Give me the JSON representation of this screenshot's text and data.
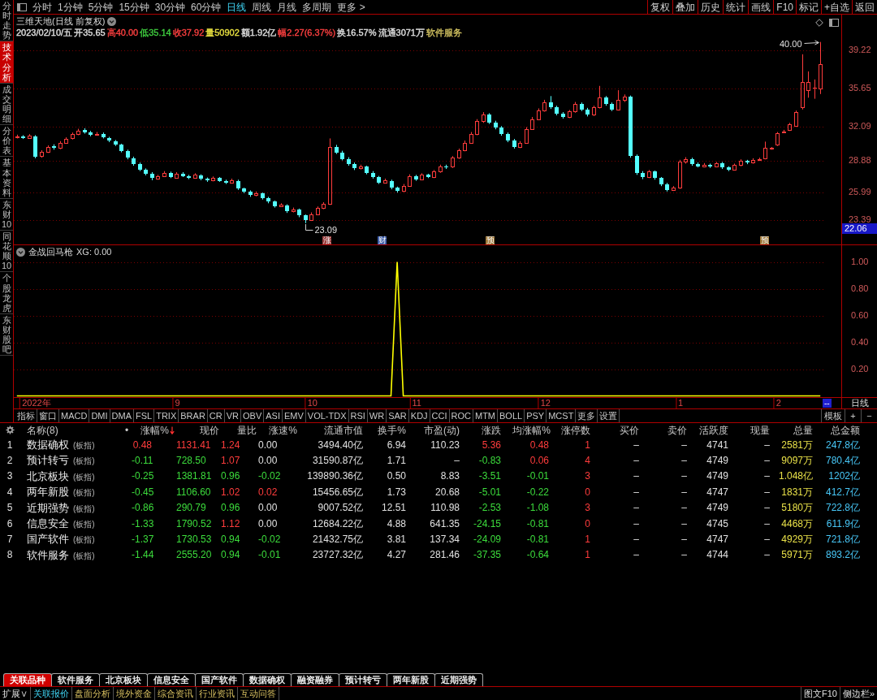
{
  "sidebar": {
    "tabs": [
      {
        "label": "分时走势",
        "selected": false
      },
      {
        "label": "技术分析",
        "selected": true
      },
      {
        "label": "成交明细",
        "selected": false
      },
      {
        "label": "分价表",
        "selected": false
      },
      {
        "label": "基本资料",
        "selected": false
      },
      {
        "label": "东财10",
        "selected": false
      },
      {
        "label": "同花顺10",
        "selected": false
      },
      {
        "label": "个股龙虎",
        "selected": false
      },
      {
        "label": "东财股吧",
        "selected": false
      }
    ]
  },
  "toolbar": {
    "periods": [
      {
        "label": "分时",
        "selected": false
      },
      {
        "label": "1分钟",
        "selected": false
      },
      {
        "label": "5分钟",
        "selected": false
      },
      {
        "label": "15分钟",
        "selected": false
      },
      {
        "label": "30分钟",
        "selected": false
      },
      {
        "label": "60分钟",
        "selected": false
      },
      {
        "label": "日线",
        "selected": true
      },
      {
        "label": "周线",
        "selected": false
      },
      {
        "label": "月线",
        "selected": false
      },
      {
        "label": "多周期",
        "selected": false
      },
      {
        "label": "更多 >",
        "selected": false
      }
    ],
    "actions": [
      "复权",
      "叠加",
      "历史",
      "统计",
      "画线",
      "F10",
      "标记",
      "+自选",
      "返回"
    ]
  },
  "quote": {
    "title": "三维天地(日线 前复权)",
    "items": [
      {
        "text": "2023/02/10/五",
        "color": "#e0e0e0"
      },
      {
        "text": "开35.65",
        "color": "#e0e0e0"
      },
      {
        "text": "高40.00",
        "color": "#ff4040"
      },
      {
        "text": "低35.14",
        "color": "#40d040"
      },
      {
        "text": "收37.92",
        "color": "#ff4040"
      },
      {
        "text": "量50902",
        "color": "#e8e040"
      },
      {
        "text": "额1.92亿",
        "color": "#e0e0e0"
      },
      {
        "text": "幅2.27(6.37%)",
        "color": "#ff4040"
      },
      {
        "text": "换16.57%",
        "color": "#e0e0e0"
      },
      {
        "text": "流通3071万",
        "color": "#e0e0e0"
      },
      {
        "text": "软件服务",
        "color": "#d0c060"
      }
    ]
  },
  "price_chart": {
    "cursor_price": "22.06",
    "high_marker": "40.00",
    "low_marker": "23.09",
    "events": [
      {
        "text": "涨",
        "color": "#9a3a3a"
      },
      {
        "text": "财",
        "color": "#3a5aa8"
      },
      {
        "text": "预",
        "color": "#a07838"
      },
      {
        "text": "预",
        "color": "#a07838"
      }
    ],
    "chart_data": {
      "type": "candlestick",
      "grid": true,
      "ylim": [
        21.11,
        42.55
      ],
      "yticks": [
        39.22,
        35.65,
        32.09,
        28.88,
        25.99,
        23.39
      ],
      "categories": [
        null,
        null,
        null,
        null,
        null,
        null,
        null,
        null,
        null,
        null,
        null,
        null,
        null,
        null,
        null,
        null,
        null,
        null,
        null,
        null,
        null,
        null,
        null,
        null,
        null,
        null,
        null,
        null,
        null,
        null,
        null,
        null,
        null,
        null,
        null,
        null,
        null,
        null,
        null,
        null,
        null,
        null,
        null,
        null,
        null,
        null,
        null,
        null,
        null,
        null,
        null,
        null,
        null,
        null,
        null,
        null,
        null,
        null,
        null,
        null,
        null,
        null,
        null,
        null,
        null,
        null,
        null,
        null,
        null,
        null,
        null,
        null,
        null,
        null,
        null,
        null,
        null,
        null,
        null,
        null,
        null,
        null,
        null,
        null,
        null,
        null,
        null,
        null,
        null,
        null,
        null,
        null,
        null,
        null,
        null,
        null,
        null,
        null,
        null,
        null,
        null,
        null,
        null,
        null,
        null,
        null,
        null,
        null,
        null,
        null,
        null,
        null,
        null,
        null,
        null,
        null,
        null,
        null,
        null,
        null,
        null,
        null,
        null,
        null,
        null,
        null,
        null,
        null,
        null,
        null,
        null,
        null
      ],
      "ohlc": [
        [
          31.1,
          31.35,
          31.0,
          31.2
        ],
        [
          31.15,
          31.3,
          30.95,
          31.05
        ],
        [
          31.05,
          31.4,
          30.98,
          31.25
        ],
        [
          31.2,
          31.3,
          29.15,
          29.3
        ],
        [
          29.35,
          29.9,
          29.2,
          29.75
        ],
        [
          29.75,
          30.35,
          29.65,
          30.2
        ],
        [
          30.25,
          30.45,
          29.95,
          30.1
        ],
        [
          30.1,
          30.75,
          30.0,
          30.6
        ],
        [
          30.6,
          31.1,
          30.5,
          30.95
        ],
        [
          31.0,
          31.55,
          30.9,
          31.4
        ],
        [
          31.4,
          31.9,
          31.3,
          31.75
        ],
        [
          31.8,
          31.95,
          31.45,
          31.55
        ],
        [
          31.55,
          31.7,
          31.2,
          31.35
        ],
        [
          31.35,
          31.6,
          31.25,
          31.45
        ],
        [
          31.45,
          31.55,
          31.0,
          31.1
        ],
        [
          31.05,
          31.15,
          30.65,
          30.8
        ],
        [
          30.75,
          30.85,
          30.3,
          30.4
        ],
        [
          30.4,
          30.5,
          29.7,
          29.8
        ],
        [
          29.8,
          29.95,
          29.05,
          29.2
        ],
        [
          29.15,
          29.3,
          28.45,
          28.6
        ],
        [
          28.6,
          28.75,
          27.95,
          28.1
        ],
        [
          28.1,
          28.2,
          27.55,
          27.7
        ],
        [
          27.7,
          27.85,
          27.1,
          27.3
        ],
        [
          27.25,
          27.6,
          27.15,
          27.45
        ],
        [
          27.5,
          27.95,
          27.4,
          27.8
        ],
        [
          27.8,
          27.9,
          27.3,
          27.4
        ],
        [
          27.35,
          27.85,
          27.25,
          27.7
        ],
        [
          27.7,
          27.85,
          27.4,
          27.5
        ],
        [
          27.5,
          27.6,
          27.2,
          27.35
        ],
        [
          27.35,
          27.75,
          27.25,
          27.6
        ],
        [
          27.55,
          27.65,
          27.1,
          27.25
        ],
        [
          27.25,
          27.35,
          26.95,
          27.1
        ],
        [
          27.1,
          27.45,
          27.0,
          27.3
        ],
        [
          27.3,
          27.4,
          26.95,
          27.05
        ],
        [
          27.05,
          27.15,
          26.75,
          26.9
        ],
        [
          26.9,
          27.25,
          26.8,
          27.1
        ],
        [
          27.05,
          27.15,
          26.2,
          26.3
        ],
        [
          26.3,
          26.4,
          25.9,
          26.05
        ],
        [
          26.05,
          26.15,
          25.55,
          25.7
        ],
        [
          25.7,
          26.05,
          25.6,
          25.9
        ],
        [
          25.85,
          25.95,
          25.3,
          25.45
        ],
        [
          25.45,
          25.55,
          24.95,
          25.1
        ],
        [
          25.1,
          25.2,
          24.55,
          24.7
        ],
        [
          24.7,
          24.95,
          24.6,
          24.8
        ],
        [
          24.75,
          24.85,
          24.05,
          24.2
        ],
        [
          24.2,
          24.55,
          24.1,
          24.4
        ],
        [
          24.35,
          24.45,
          23.65,
          23.8
        ],
        [
          23.8,
          23.9,
          23.09,
          23.35
        ],
        [
          23.4,
          24.1,
          23.3,
          23.95
        ],
        [
          23.95,
          24.65,
          23.85,
          24.5
        ],
        [
          24.5,
          25.05,
          24.4,
          24.9
        ],
        [
          24.9,
          31.0,
          24.8,
          30.2
        ],
        [
          30.2,
          30.4,
          29.55,
          29.7
        ],
        [
          29.7,
          29.85,
          28.95,
          29.1
        ],
        [
          29.1,
          29.25,
          28.45,
          28.6
        ],
        [
          28.6,
          28.75,
          28.05,
          28.2
        ],
        [
          28.2,
          28.55,
          28.1,
          28.4
        ],
        [
          28.35,
          28.45,
          27.65,
          27.8
        ],
        [
          27.8,
          27.95,
          27.25,
          27.4
        ],
        [
          27.4,
          27.5,
          26.75,
          26.9
        ],
        [
          26.9,
          27.25,
          26.8,
          27.1
        ],
        [
          27.05,
          27.15,
          26.25,
          26.4
        ],
        [
          26.4,
          26.5,
          25.95,
          26.1
        ],
        [
          26.1,
          26.75,
          26.0,
          26.6
        ],
        [
          26.6,
          27.65,
          26.5,
          27.5
        ],
        [
          27.5,
          27.6,
          27.05,
          27.2
        ],
        [
          27.2,
          27.75,
          27.1,
          27.6
        ],
        [
          27.6,
          27.7,
          27.3,
          27.4
        ],
        [
          27.4,
          28.05,
          27.3,
          27.9
        ],
        [
          27.9,
          28.55,
          27.8,
          28.4
        ],
        [
          28.4,
          28.55,
          28.15,
          28.3
        ],
        [
          28.35,
          29.35,
          28.25,
          29.2
        ],
        [
          29.2,
          30.05,
          29.1,
          29.9
        ],
        [
          29.9,
          30.8,
          29.8,
          30.6
        ],
        [
          30.6,
          31.6,
          30.5,
          31.4
        ],
        [
          31.4,
          32.8,
          31.3,
          32.6
        ],
        [
          32.6,
          33.45,
          32.45,
          33.2
        ],
        [
          33.2,
          33.35,
          32.35,
          32.5
        ],
        [
          32.5,
          32.65,
          31.85,
          32.0
        ],
        [
          32.0,
          32.15,
          31.25,
          31.4
        ],
        [
          31.4,
          31.55,
          30.65,
          30.8
        ],
        [
          30.8,
          30.95,
          30.05,
          30.2
        ],
        [
          30.2,
          30.75,
          30.1,
          30.6
        ],
        [
          30.6,
          32.05,
          30.5,
          31.9
        ],
        [
          31.9,
          33.0,
          31.8,
          32.8
        ],
        [
          32.8,
          33.8,
          32.7,
          33.6
        ],
        [
          33.6,
          34.6,
          33.5,
          34.4
        ],
        [
          34.4,
          34.95,
          33.75,
          33.9
        ],
        [
          33.9,
          34.05,
          33.15,
          33.3
        ],
        [
          33.3,
          33.45,
          32.85,
          33.0
        ],
        [
          33.0,
          33.65,
          32.9,
          33.5
        ],
        [
          33.5,
          34.4,
          33.4,
          34.2
        ],
        [
          34.2,
          34.35,
          33.55,
          33.7
        ],
        [
          33.7,
          33.85,
          33.05,
          33.2
        ],
        [
          33.2,
          34.05,
          33.1,
          33.9
        ],
        [
          33.9,
          35.9,
          33.8,
          34.8
        ],
        [
          34.8,
          34.95,
          34.05,
          34.2
        ],
        [
          34.2,
          34.35,
          33.55,
          33.7
        ],
        [
          33.7,
          35.5,
          33.6,
          34.6
        ],
        [
          34.6,
          35.1,
          34.4,
          34.9
        ],
        [
          34.9,
          35.0,
          29.2,
          29.4
        ],
        [
          29.4,
          29.5,
          27.6,
          27.8
        ],
        [
          27.8,
          27.95,
          27.2,
          27.4
        ],
        [
          27.4,
          28.05,
          27.3,
          27.9
        ],
        [
          27.9,
          28.0,
          27.15,
          27.3
        ],
        [
          27.3,
          27.4,
          26.55,
          26.7
        ],
        [
          26.7,
          26.85,
          26.05,
          26.2
        ],
        [
          26.2,
          26.55,
          26.1,
          26.4
        ],
        [
          26.4,
          29.0,
          26.3,
          28.8
        ],
        [
          28.8,
          29.25,
          28.65,
          29.1
        ],
        [
          29.1,
          29.2,
          28.45,
          28.6
        ],
        [
          28.6,
          28.75,
          28.3,
          28.4
        ],
        [
          28.4,
          28.7,
          28.3,
          28.55
        ],
        [
          28.55,
          28.65,
          28.25,
          28.4
        ],
        [
          28.4,
          28.8,
          28.3,
          28.65
        ],
        [
          28.65,
          28.8,
          28.15,
          28.3
        ],
        [
          28.3,
          28.4,
          27.95,
          28.1
        ],
        [
          28.1,
          28.65,
          28.0,
          28.5
        ],
        [
          28.5,
          29.05,
          28.4,
          28.9
        ],
        [
          28.9,
          29.0,
          28.6,
          28.75
        ],
        [
          28.75,
          29.15,
          28.65,
          29.0
        ],
        [
          29.0,
          29.2,
          28.9,
          29.05
        ],
        [
          29.15,
          30.7,
          29.05,
          30.1
        ],
        [
          30.05,
          30.2,
          29.95,
          30.1
        ],
        [
          30.45,
          31.6,
          30.3,
          31.5
        ],
        [
          31.6,
          31.8,
          31.5,
          31.65
        ],
        [
          31.8,
          32.45,
          31.7,
          32.3
        ],
        [
          32.2,
          33.6,
          32.1,
          33.45
        ],
        [
          33.9,
          38.85,
          33.7,
          36.25
        ],
        [
          35.5,
          37.25,
          34.8,
          36.25
        ],
        [
          35.7,
          36.5,
          34.7,
          35.75
        ],
        [
          35.65,
          40.0,
          35.14,
          37.92
        ]
      ]
    }
  },
  "indicator": {
    "name": "金战回马枪",
    "reading": "XG: 0.00",
    "range_button": "--",
    "period_label": "日线",
    "chart_data": {
      "type": "line",
      "grid": true,
      "ylim": [
        0,
        1
      ],
      "yticks": [
        {
          "value": 0.2,
          "label": "0.20"
        },
        {
          "value": 0.4,
          "label": "0.40"
        },
        {
          "value": 0.6,
          "label": "0.60"
        },
        {
          "value": 0.8,
          "label": "0.80"
        },
        {
          "value": 1,
          "label": "1.00"
        }
      ],
      "categories": [
        null,
        null,
        null,
        "2022年",
        null,
        null,
        null,
        null,
        null,
        null,
        null,
        null,
        null,
        null,
        null,
        null,
        null,
        null,
        null,
        null,
        null,
        null,
        null,
        null,
        null,
        null,
        "9",
        null,
        null,
        null,
        null,
        null,
        null,
        null,
        null,
        null,
        null,
        null,
        null,
        null,
        null,
        null,
        null,
        null,
        null,
        null,
        null,
        null,
        "10",
        null,
        null,
        null,
        null,
        null,
        null,
        null,
        null,
        null,
        null,
        null,
        null,
        null,
        null,
        null,
        null,
        "11",
        null,
        null,
        null,
        null,
        null,
        null,
        null,
        null,
        null,
        null,
        null,
        null,
        null,
        null,
        null,
        null,
        null,
        null,
        null,
        null,
        "12",
        null,
        null,
        null,
        null,
        null,
        null,
        null,
        null,
        null,
        null,
        null,
        null,
        null,
        null,
        null,
        null,
        null,
        null,
        null,
        null,
        null,
        "1",
        null,
        null,
        null,
        null,
        null,
        null,
        null,
        null,
        null,
        null,
        null,
        null,
        null,
        null,
        null,
        "2",
        null,
        null,
        null,
        null,
        null,
        null,
        null
      ],
      "series": [
        {
          "color": "#ffff00",
          "values": [
            0,
            0,
            0,
            0,
            0,
            0,
            0,
            0,
            0,
            0,
            0,
            0,
            0,
            0,
            0,
            0,
            0,
            0,
            0,
            0,
            0,
            0,
            0,
            0,
            0,
            0,
            0,
            0,
            0,
            0,
            0,
            0,
            0,
            0,
            0,
            0,
            0,
            0,
            0,
            0,
            0,
            0,
            0,
            0,
            0,
            0,
            0,
            0,
            0,
            0,
            0,
            0,
            0,
            0,
            0,
            0,
            0,
            0,
            0,
            0,
            0,
            0,
            1,
            0,
            0,
            0,
            0,
            0,
            0,
            0,
            0,
            0,
            0,
            0,
            0,
            0,
            0,
            0,
            0,
            0,
            0,
            0,
            0,
            0,
            0,
            0,
            0,
            0,
            0,
            0,
            0,
            0,
            0,
            0,
            0,
            0,
            0,
            0,
            0,
            0,
            0,
            0,
            0,
            0,
            0,
            0,
            0,
            0,
            0,
            0,
            0,
            0,
            0,
            0,
            0,
            0,
            0,
            0,
            0,
            0,
            0,
            0,
            0,
            0,
            0,
            0,
            0,
            0,
            0,
            0,
            0,
            0
          ]
        }
      ]
    }
  },
  "indicator_tabs": {
    "items": [
      "指标",
      "窗口",
      "MACD",
      "DMI",
      "DMA",
      "FSL",
      "TRIX",
      "BRAR",
      "CR",
      "VR",
      "OBV",
      "ASI",
      "EMV",
      "VOL-TDX",
      "RSI",
      "WR",
      "SAR",
      "KDJ",
      "CCI",
      "ROC",
      "MTM",
      "BOLL",
      "PSY",
      "MCST",
      "更多",
      "设置"
    ],
    "right": [
      "模板",
      "+",
      "−"
    ]
  },
  "table": {
    "columns": [
      {
        "label": "名称(8)",
        "sorted": false
      },
      {
        "label": "•",
        "sorted": false
      },
      {
        "label": "涨幅%",
        "sorted": true
      },
      {
        "label": "现价",
        "sorted": false
      },
      {
        "label": "量比",
        "sorted": false
      },
      {
        "label": "涨速%",
        "sorted": false
      },
      {
        "label": "流通市值",
        "sorted": false
      },
      {
        "label": "换手%",
        "sorted": false
      },
      {
        "label": "市盈(动)",
        "sorted": false
      },
      {
        "label": "涨跌",
        "sorted": false
      },
      {
        "label": "均涨幅%",
        "sorted": false
      },
      {
        "label": "涨停数",
        "sorted": false
      },
      {
        "label": "买价",
        "sorted": false
      },
      {
        "label": "卖价",
        "sorted": false
      },
      {
        "label": "活跃度",
        "sorted": false
      },
      {
        "label": "现量",
        "sorted": false
      },
      {
        "label": "总量",
        "sorted": false
      },
      {
        "label": "总金额",
        "sorted": false
      }
    ],
    "rows": [
      {
        "index": "1",
        "cells": [
          {
            "text": "数据确权",
            "tag": "(板指)"
          },
          {
            "text": ""
          },
          {
            "text": "0.48",
            "color": "#ff3c3c"
          },
          {
            "text": "1131.41",
            "color": "#ff3c3c"
          },
          {
            "text": "1.24",
            "color": "#ff3c3c"
          },
          {
            "text": "0.00",
            "color": "#e0e0e0"
          },
          {
            "text": "3494.40亿"
          },
          {
            "text": "6.94"
          },
          {
            "text": "110.23"
          },
          {
            "text": "5.36",
            "color": "#ff3c3c"
          },
          {
            "text": "0.48",
            "color": "#ff3c3c"
          },
          {
            "text": "1"
          },
          {
            "text": "–"
          },
          {
            "text": "–"
          },
          {
            "text": "4741"
          },
          {
            "text": "–"
          },
          {
            "text": "2581万"
          },
          {
            "text": "247.8亿"
          }
        ]
      },
      {
        "index": "2",
        "cells": [
          {
            "text": "预计转亏",
            "tag": "(板指)"
          },
          {
            "text": ""
          },
          {
            "text": "-0.11",
            "color": "#3cdc3c"
          },
          {
            "text": "728.50",
            "color": "#3cdc3c"
          },
          {
            "text": "1.07",
            "color": "#ff3c3c"
          },
          {
            "text": "0.00",
            "color": "#e0e0e0"
          },
          {
            "text": "31590.87亿"
          },
          {
            "text": "1.71"
          },
          {
            "text": "–"
          },
          {
            "text": "-0.83",
            "color": "#3cdc3c"
          },
          {
            "text": "0.06",
            "color": "#ff3c3c"
          },
          {
            "text": "4"
          },
          {
            "text": "–"
          },
          {
            "text": "–"
          },
          {
            "text": "4749"
          },
          {
            "text": "–"
          },
          {
            "text": "9097万"
          },
          {
            "text": "780.4亿"
          }
        ]
      },
      {
        "index": "3",
        "cells": [
          {
            "text": "北京板块",
            "tag": "(板指)"
          },
          {
            "text": ""
          },
          {
            "text": "-0.25",
            "color": "#3cdc3c"
          },
          {
            "text": "1381.81",
            "color": "#3cdc3c"
          },
          {
            "text": "0.96",
            "color": "#3cdc3c"
          },
          {
            "text": "-0.02",
            "color": "#3cdc3c"
          },
          {
            "text": "139890.36亿"
          },
          {
            "text": "0.50"
          },
          {
            "text": "8.83"
          },
          {
            "text": "-3.51",
            "color": "#3cdc3c"
          },
          {
            "text": "-0.01",
            "color": "#3cdc3c"
          },
          {
            "text": "3"
          },
          {
            "text": "–"
          },
          {
            "text": "–"
          },
          {
            "text": "4749"
          },
          {
            "text": "–"
          },
          {
            "text": "1.048亿"
          },
          {
            "text": "1202亿"
          }
        ]
      },
      {
        "index": "4",
        "cells": [
          {
            "text": "两年新股",
            "tag": "(板指)"
          },
          {
            "text": ""
          },
          {
            "text": "-0.45",
            "color": "#3cdc3c"
          },
          {
            "text": "1106.60",
            "color": "#3cdc3c"
          },
          {
            "text": "1.02",
            "color": "#ff3c3c"
          },
          {
            "text": "0.02",
            "color": "#ff3c3c"
          },
          {
            "text": "15456.65亿"
          },
          {
            "text": "1.73"
          },
          {
            "text": "20.68"
          },
          {
            "text": "-5.01",
            "color": "#3cdc3c"
          },
          {
            "text": "-0.22",
            "color": "#3cdc3c"
          },
          {
            "text": "0"
          },
          {
            "text": "–"
          },
          {
            "text": "–"
          },
          {
            "text": "4747"
          },
          {
            "text": "–"
          },
          {
            "text": "1831万"
          },
          {
            "text": "412.7亿"
          }
        ]
      },
      {
        "index": "5",
        "cells": [
          {
            "text": "近期强势",
            "tag": "(板指)"
          },
          {
            "text": ""
          },
          {
            "text": "-0.86",
            "color": "#3cdc3c"
          },
          {
            "text": "290.79",
            "color": "#3cdc3c"
          },
          {
            "text": "0.96",
            "color": "#3cdc3c"
          },
          {
            "text": "0.00",
            "color": "#e0e0e0"
          },
          {
            "text": "9007.52亿"
          },
          {
            "text": "12.51"
          },
          {
            "text": "110.98"
          },
          {
            "text": "-2.53",
            "color": "#3cdc3c"
          },
          {
            "text": "-1.08",
            "color": "#3cdc3c"
          },
          {
            "text": "3"
          },
          {
            "text": "–"
          },
          {
            "text": "–"
          },
          {
            "text": "4749"
          },
          {
            "text": "–"
          },
          {
            "text": "5180万"
          },
          {
            "text": "722.8亿"
          }
        ]
      },
      {
        "index": "6",
        "cells": [
          {
            "text": "信息安全",
            "tag": "(板指)"
          },
          {
            "text": ""
          },
          {
            "text": "-1.33",
            "color": "#3cdc3c"
          },
          {
            "text": "1790.52",
            "color": "#3cdc3c"
          },
          {
            "text": "1.12",
            "color": "#ff3c3c"
          },
          {
            "text": "0.00",
            "color": "#e0e0e0"
          },
          {
            "text": "12684.22亿"
          },
          {
            "text": "4.88"
          },
          {
            "text": "641.35"
          },
          {
            "text": "-24.15",
            "color": "#3cdc3c"
          },
          {
            "text": "-0.81",
            "color": "#3cdc3c"
          },
          {
            "text": "0"
          },
          {
            "text": "–"
          },
          {
            "text": "–"
          },
          {
            "text": "4745"
          },
          {
            "text": "–"
          },
          {
            "text": "4468万"
          },
          {
            "text": "611.9亿"
          }
        ]
      },
      {
        "index": "7",
        "cells": [
          {
            "text": "国产软件",
            "tag": "(板指)"
          },
          {
            "text": ""
          },
          {
            "text": "-1.37",
            "color": "#3cdc3c"
          },
          {
            "text": "1730.53",
            "color": "#3cdc3c"
          },
          {
            "text": "0.94",
            "color": "#3cdc3c"
          },
          {
            "text": "-0.02",
            "color": "#3cdc3c"
          },
          {
            "text": "21432.75亿"
          },
          {
            "text": "3.81"
          },
          {
            "text": "137.34"
          },
          {
            "text": "-24.09",
            "color": "#3cdc3c"
          },
          {
            "text": "-0.81",
            "color": "#3cdc3c"
          },
          {
            "text": "1"
          },
          {
            "text": "–"
          },
          {
            "text": "–"
          },
          {
            "text": "4747"
          },
          {
            "text": "–"
          },
          {
            "text": "4929万"
          },
          {
            "text": "721.8亿"
          }
        ]
      },
      {
        "index": "8",
        "cells": [
          {
            "text": "软件服务",
            "tag": "(板指)"
          },
          {
            "text": ""
          },
          {
            "text": "-1.44",
            "color": "#3cdc3c"
          },
          {
            "text": "2555.20",
            "color": "#3cdc3c"
          },
          {
            "text": "0.94",
            "color": "#3cdc3c"
          },
          {
            "text": "-0.01",
            "color": "#3cdc3c"
          },
          {
            "text": "23727.32亿"
          },
          {
            "text": "4.27"
          },
          {
            "text": "281.46"
          },
          {
            "text": "-37.35",
            "color": "#3cdc3c"
          },
          {
            "text": "-0.64",
            "color": "#3cdc3c"
          },
          {
            "text": "1"
          },
          {
            "text": "–"
          },
          {
            "text": "–"
          },
          {
            "text": "4744"
          },
          {
            "text": "–"
          },
          {
            "text": "5971万"
          },
          {
            "text": "893.2亿"
          }
        ]
      }
    ]
  },
  "related_tabs": [
    {
      "label": "关联品种",
      "selected": true
    },
    {
      "label": "软件服务",
      "selected": false
    },
    {
      "label": "北京板块",
      "selected": false
    },
    {
      "label": "信息安全",
      "selected": false
    },
    {
      "label": "国产软件",
      "selected": false
    },
    {
      "label": "数据确权",
      "selected": false
    },
    {
      "label": "融资融券",
      "selected": false
    },
    {
      "label": "预计转亏",
      "selected": false
    },
    {
      "label": "两年新股",
      "selected": false
    },
    {
      "label": "近期强势",
      "selected": false
    }
  ],
  "status_bar": {
    "expand": "扩展∨",
    "links": [
      {
        "label": "关联报价",
        "selected": true
      },
      {
        "label": "盘面分析",
        "selected": false
      },
      {
        "label": "境外资金",
        "selected": false
      },
      {
        "label": "综合资讯",
        "selected": false
      },
      {
        "label": "行业资讯",
        "selected": false
      },
      {
        "label": "互动问答",
        "selected": false
      }
    ],
    "right": [
      "图文F10",
      "侧边栏»"
    ]
  }
}
